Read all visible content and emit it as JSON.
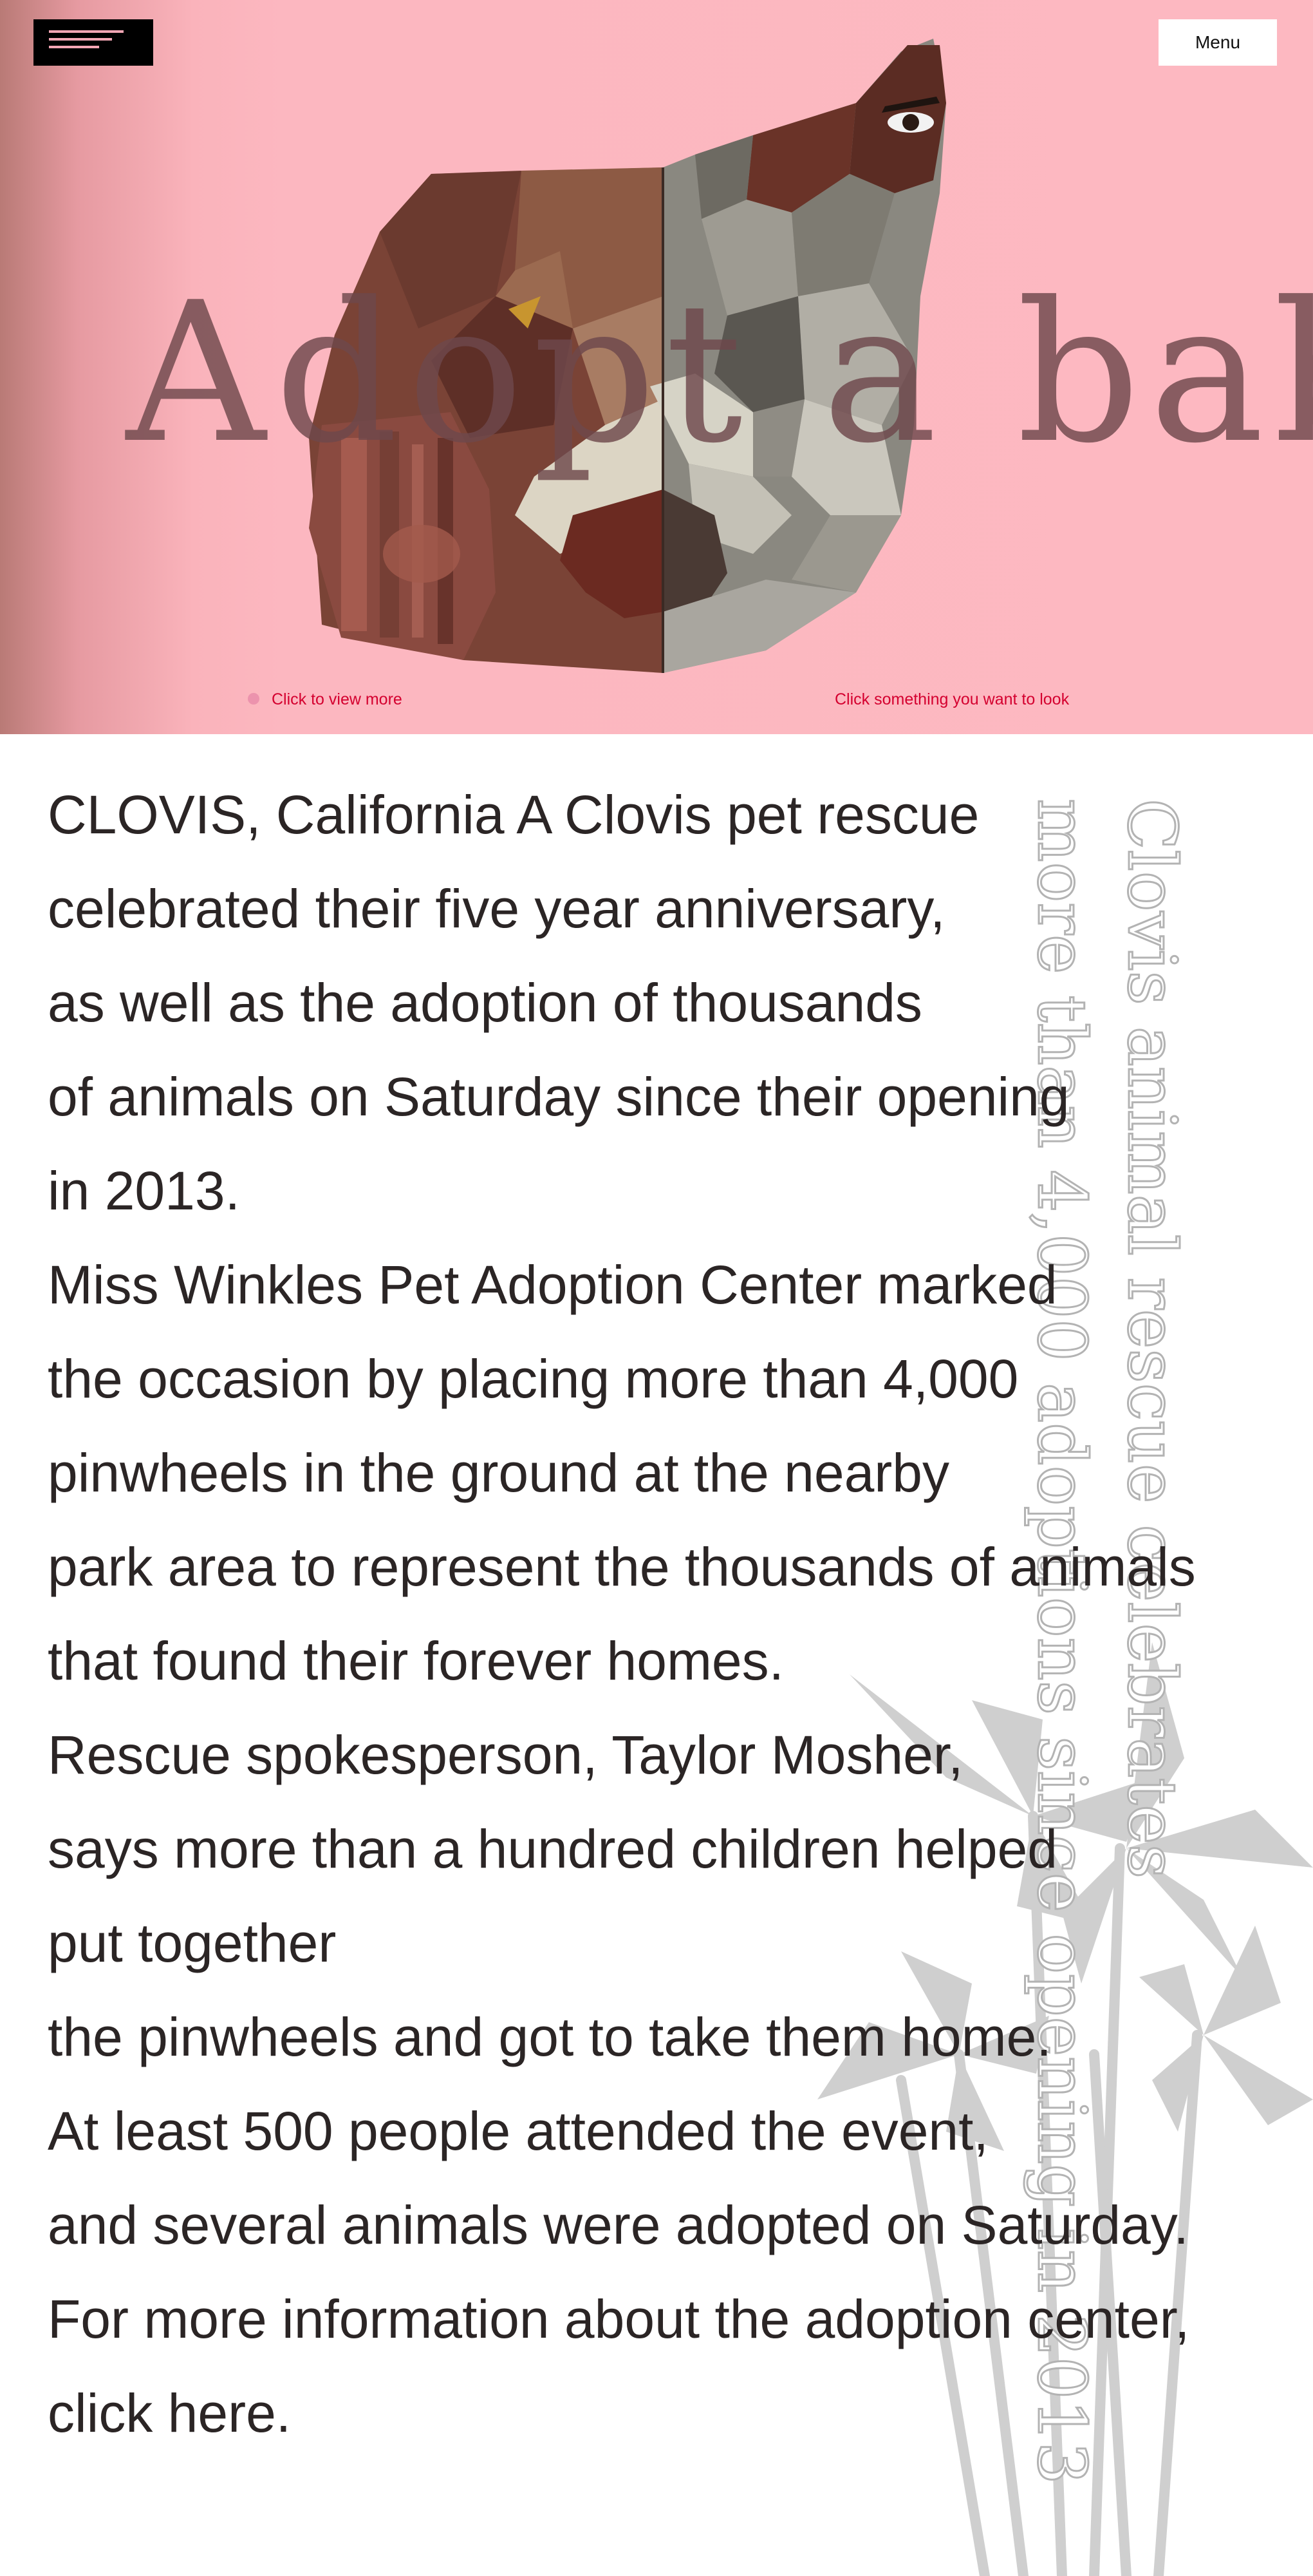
{
  "header": {
    "logo_label": "",
    "menu_label": "Menu"
  },
  "hero": {
    "title": "Adopt a baby",
    "link_left": "Click to view more",
    "link_right": "Click something you want to look"
  },
  "article": {
    "vertical_heading_line1": "Clovis animal rescue celebrates",
    "vertical_heading_line2": "more than 4,000 adoptions since opening in 2013",
    "lines": [
      "CLOVIS, California A Clovis pet rescue",
      "celebrated their five year anniversary,",
      "as well as the adoption of thousands",
      "of animals on Saturday since their opening",
      "in 2013.",
      "Miss Winkles Pet Adoption Center marked",
      "the occasion by placing more than 4,000",
      "pinwheels in the ground at the nearby",
      "park area to represent the thousands of animals",
      "that found their forever homes.",
      "Rescue spokesperson, Taylor Mosher,",
      "says more than a hundred children helped",
      "put together",
      "the pinwheels and got to take them home.",
      "At least 500 people attended the event,",
      "and several animals were adopted on Saturday.",
      "For more information about the adoption center,"
    ],
    "link_text": "click here."
  },
  "colors": {
    "hero_bg": "#fdb8c1",
    "title": "#6e484c",
    "link": "#d4002f",
    "body_text": "#2b2525",
    "pinwheel": "#cfcfcf"
  },
  "icons": [
    "menu-lines-icon",
    "dot-icon",
    "pinwheel-illustration",
    "dog-illustration"
  ]
}
